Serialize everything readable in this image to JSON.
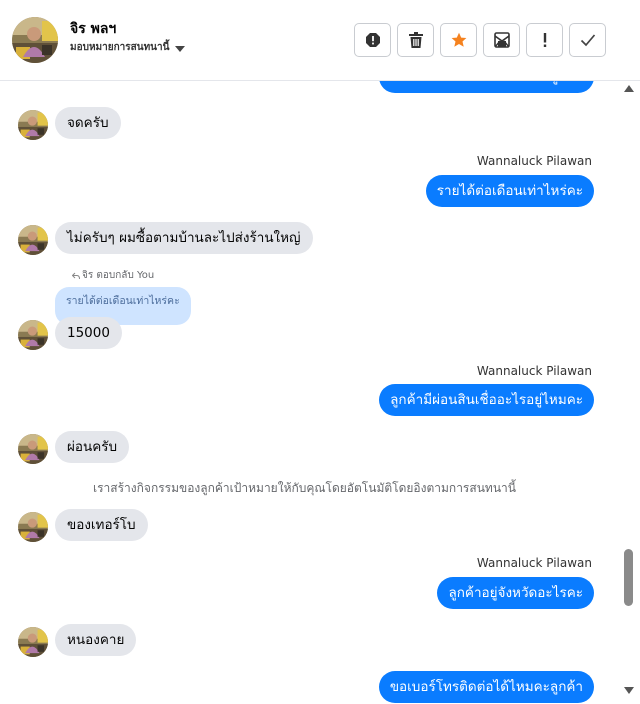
{
  "header": {
    "name": "จิร พลฯ",
    "status": "มอบหมายการสนทนานี้",
    "actions": [
      {
        "name": "report-icon"
      },
      {
        "name": "trash-icon"
      },
      {
        "name": "star-icon",
        "color": "#f5821f"
      },
      {
        "name": "mark-unread-icon"
      },
      {
        "name": "exclamation-icon"
      },
      {
        "name": "check-icon"
      }
    ]
  },
  "thread": {
    "m0": "ขอเบอร์โทรติดต่อได้ไหมคะลูกค้า",
    "m1": "จดครับ",
    "m2_sender": "Wannaluck Pilawan",
    "m2": "รายได้ต่อเดือนเท่าไหร่คะ",
    "m3": "ไม่ครับๆ ผมซื้อตามบ้านละไปส่งร้านใหญ่",
    "reply_label": "จิร ตอบกลับ You",
    "quote": "รายได้ต่อเดือนเท่าไหร่คะ",
    "m4": "15000",
    "m5_sender": "Wannaluck Pilawan",
    "m5": "ลูกค้ามีผ่อนสินเชื่ออะไรอยู่ไหมคะ",
    "m6": "ผ่อนครับ",
    "system": "เราสร้างกิจกรรมของลูกค้าเป้าหมายให้กับคุณโดยอัตโนมัติโดยอิงตามการสนทนานี้",
    "m7": "ของเทอร์โบ",
    "m8_sender": "Wannaluck Pilawan",
    "m8": "ลูกค้าอยู่จังหวัดอะไรคะ",
    "m9": "หนองคาย",
    "m10": "ขอเบอร์โทรติดต่อได้ไหมคะลูกค้า"
  },
  "colors": {
    "outgoing_bubble": "#0a7cff",
    "incoming_bubble": "#e4e6eb",
    "quote_bubble": "#cfe4ff"
  }
}
